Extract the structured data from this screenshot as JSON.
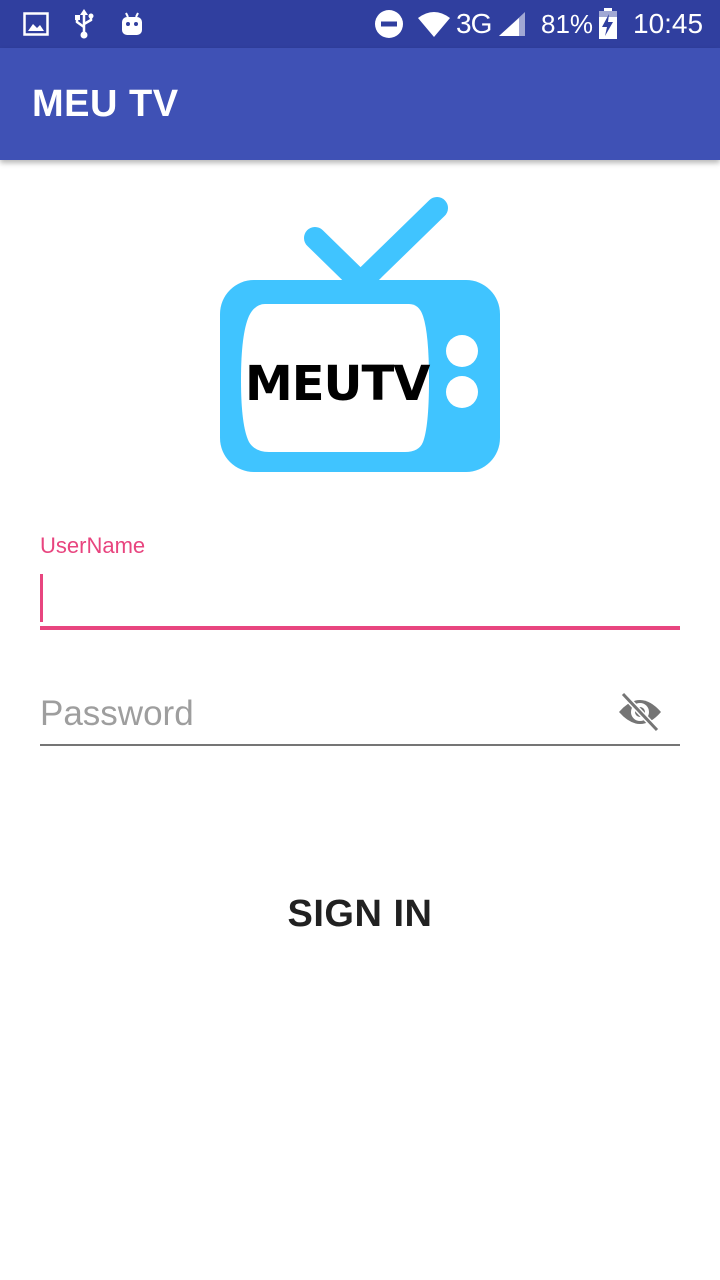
{
  "status_bar": {
    "icons": [
      "image-icon",
      "usb-icon",
      "android-icon",
      "do-not-disturb-icon",
      "wifi-icon",
      "signal-icon",
      "battery-charging-icon"
    ],
    "network": "3G",
    "battery": "81%",
    "time": "10:45"
  },
  "app_bar": {
    "title": "MEU TV"
  },
  "logo": {
    "text": "MEUTV",
    "icon": "tv-logo-icon",
    "color": "#40c4ff"
  },
  "form": {
    "username_label": "UserName",
    "username_value": "",
    "password_placeholder": "Password",
    "password_value": "",
    "password_toggle_icon": "eye-off-icon",
    "accent_color": "#e8457f"
  },
  "actions": {
    "sign_in_label": "SIGN IN"
  },
  "colors": {
    "status_bar": "#303f9f",
    "app_bar": "#3f51b5"
  }
}
